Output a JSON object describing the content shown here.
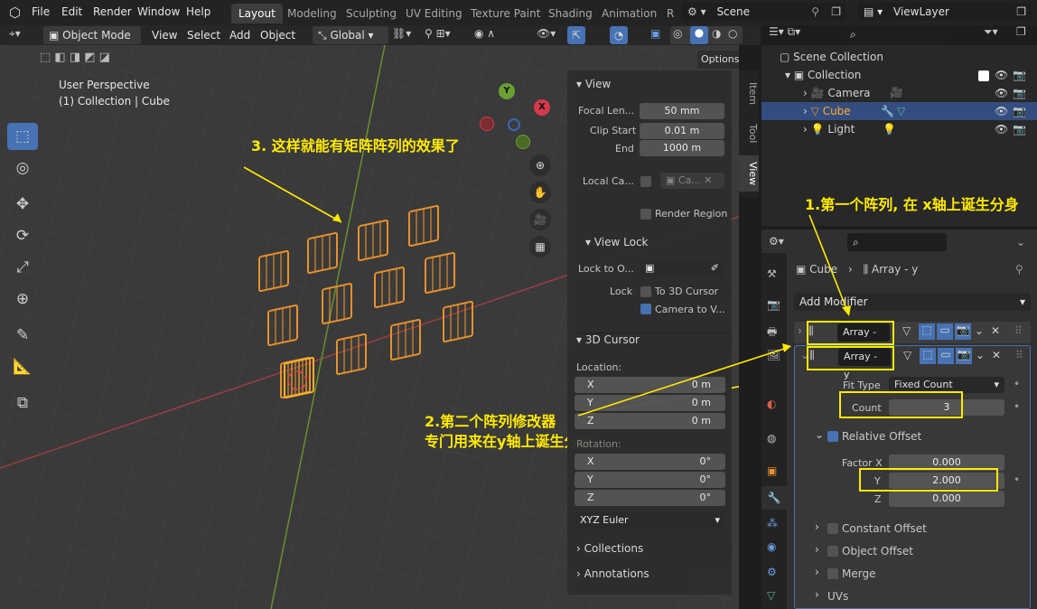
{
  "topbar": {
    "menus": [
      "File",
      "Edit",
      "Render",
      "Window",
      "Help"
    ],
    "workspaces": [
      "Layout",
      "Modeling",
      "Sculpting",
      "UV Editing",
      "Texture Paint",
      "Shading",
      "Animation",
      "R"
    ],
    "scene": "Scene",
    "view_layer": "ViewLayer"
  },
  "header": {
    "mode": "Object Mode",
    "menus": [
      "View",
      "Select",
      "Add",
      "Object"
    ],
    "orientation": "Global",
    "options": "Options"
  },
  "viewport": {
    "perspective": "User Perspective",
    "collection_info": "(1) Collection | Cube",
    "gizmo": {
      "x": "X",
      "y": "Y"
    }
  },
  "npanel": {
    "tabs": [
      "Item",
      "Tool",
      "View"
    ],
    "view": {
      "title": "View",
      "focal_label": "Focal Len...",
      "focal": "50 mm",
      "clip_start_label": "Clip Start",
      "clip_start": "0.01 m",
      "end_label": "End",
      "end": "1000 m",
      "local_cam_label": "Local Ca...",
      "local_cam": "Ca...",
      "render_region": "Render Region"
    },
    "view_lock": {
      "title": "View Lock",
      "lock_to_label": "Lock to O...",
      "lock_label": "Lock",
      "to_3d_cursor": "To 3D Cursor",
      "camera_to_view": "Camera to V..."
    },
    "cursor": {
      "title": "3D Cursor",
      "location": "Location:",
      "rotation": "Rotation:",
      "loc": [
        {
          "axis": "X",
          "val": "0 m"
        },
        {
          "axis": "Y",
          "val": "0 m"
        },
        {
          "axis": "Z",
          "val": "0 m"
        }
      ],
      "rot": [
        {
          "axis": "X",
          "val": "0°"
        },
        {
          "axis": "Y",
          "val": "0°"
        },
        {
          "axis": "Z",
          "val": "0°"
        }
      ],
      "rot_mode": "XYZ Euler"
    },
    "collections": "Collections",
    "annotations": "Annotations"
  },
  "outliner": {
    "scene_collection": "Scene Collection",
    "collection": "Collection",
    "items": [
      "Camera",
      "Cube",
      "Light"
    ]
  },
  "properties": {
    "breadcrumb_obj": "Cube",
    "breadcrumb_mod": "Array - y",
    "add_modifier": "Add Modifier",
    "mod1": "Array - x",
    "mod2": "Array - y",
    "fit_type_label": "Fit Type",
    "fit_type": "Fixed Count",
    "count_label": "Count",
    "count": "3",
    "relative_offset": "Relative Offset",
    "factor_x_label": "Factor X",
    "factor_x": "0.000",
    "y_label": "Y",
    "y": "2.000",
    "z_label": "Z",
    "z": "0.000",
    "constant_offset": "Constant Offset",
    "object_offset": "Object Offset",
    "merge": "Merge",
    "uvs": "UVs"
  },
  "annotations": {
    "a1": "1.第一个阵列, 在 x轴上诞生分身",
    "a2_line1": "2.第二个阵列修改器",
    "a2_line2": "专门用来在y轴上诞生分身",
    "a3": "3. 这样就能有矩阵阵列的效果了"
  },
  "colors": {
    "accent": "#4772b3",
    "annotation": "#ffea00",
    "wire": "#e8912c"
  }
}
